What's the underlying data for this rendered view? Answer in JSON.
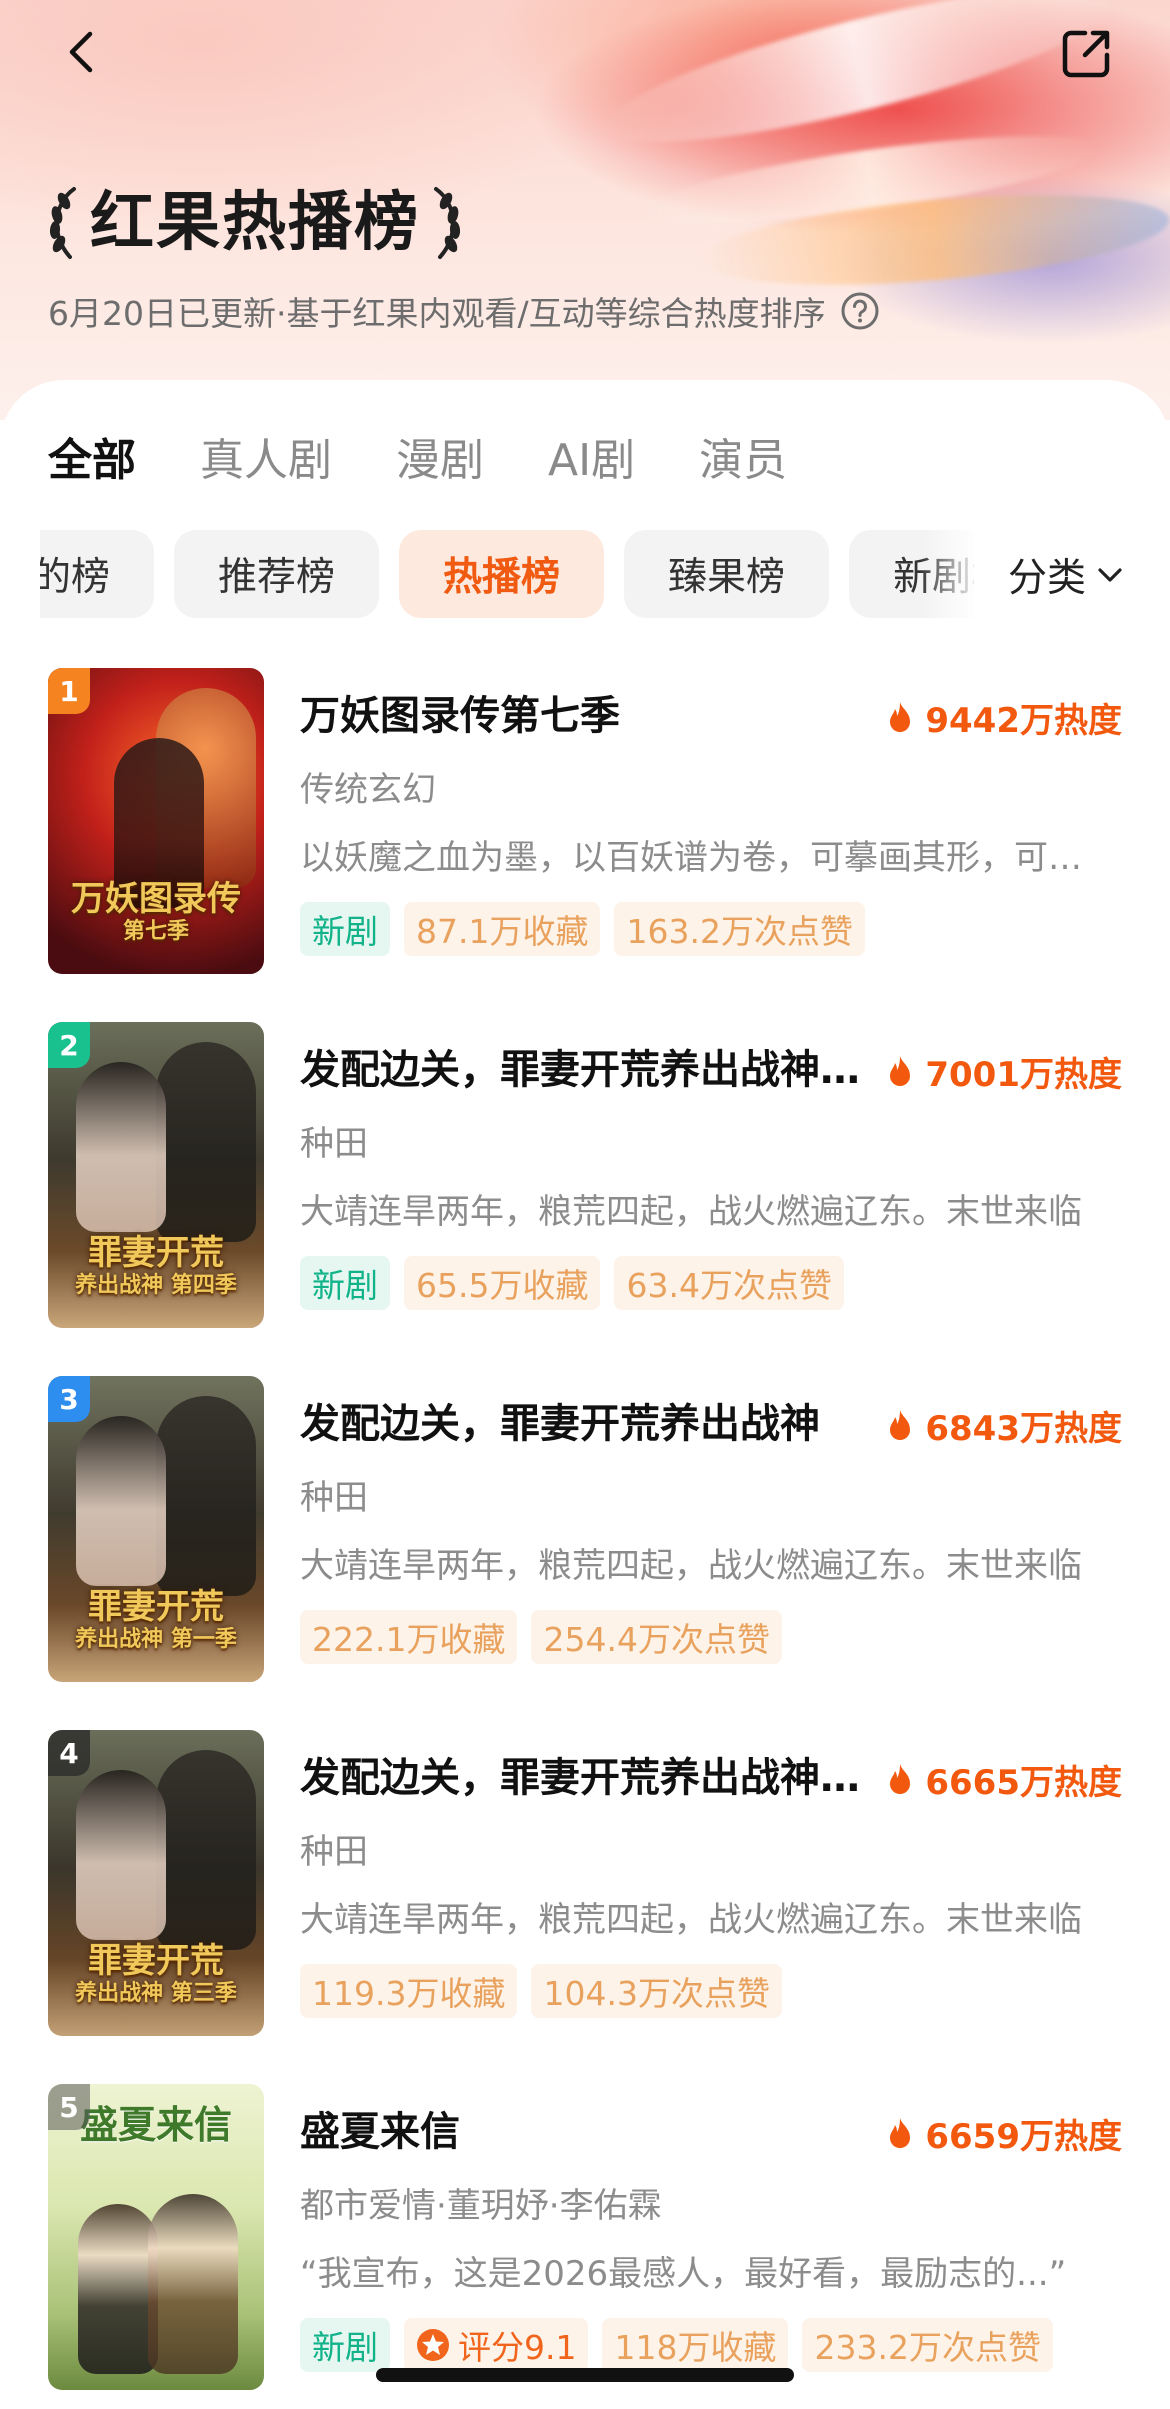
{
  "header": {
    "title": "红果热播榜",
    "subtitle": "6月20日已更新·基于红果内观看/互动等综合热度排序",
    "back_icon": "chevron-left-icon",
    "share_icon": "share-icon",
    "help_icon": "question-circle-icon"
  },
  "main_tabs": [
    {
      "label": "全部",
      "active": true
    },
    {
      "label": "真人剧",
      "active": false
    },
    {
      "label": "漫剧",
      "active": false
    },
    {
      "label": "AI剧",
      "active": false
    },
    {
      "label": "演员",
      "active": false
    }
  ],
  "chips": [
    {
      "label": "的榜",
      "active": false
    },
    {
      "label": "推荐榜",
      "active": false
    },
    {
      "label": "热播榜",
      "active": true
    },
    {
      "label": "臻果榜",
      "active": false
    },
    {
      "label": "新剧榜",
      "active": false
    }
  ],
  "category": {
    "label": "分类",
    "icon": "chevron-down-icon"
  },
  "colors": {
    "accent": "#f2590f",
    "new_tag": "#13b38a",
    "stat_tag": "#e9a25e",
    "rank1": "#f5831f",
    "rank2": "#19c18f",
    "rank3": "#2e8ef0",
    "rank_other": "#4a4a4a"
  },
  "items": [
    {
      "rank": "1",
      "title": "万妖图录传第七季",
      "heat": "9442万热度",
      "genre": "传统玄幻",
      "desc": "以妖魔之血为墨，以百妖谱为卷，可摹画其形，可借用其力",
      "cover_text": "万妖图录传",
      "cover_sub": "第七季",
      "tags": [
        {
          "type": "new",
          "text": "新剧"
        },
        {
          "type": "stat",
          "text": "87.1万收藏"
        },
        {
          "type": "stat",
          "text": "163.2万次点赞"
        }
      ]
    },
    {
      "rank": "2",
      "title": "发配边关，罪妻开荒养出战神第四季",
      "heat": "7001万热度",
      "genre": "种田",
      "desc": "大靖连旱两年，粮荒四起，战火燃遍辽东。末世来临",
      "cover_text": "罪妻开荒",
      "cover_sub": "养出战神 第四季",
      "tags": [
        {
          "type": "new",
          "text": "新剧"
        },
        {
          "type": "stat",
          "text": "65.5万收藏"
        },
        {
          "type": "stat",
          "text": "63.4万次点赞"
        }
      ]
    },
    {
      "rank": "3",
      "title": "发配边关，罪妻开荒养出战神",
      "heat": "6843万热度",
      "genre": "种田",
      "desc": "大靖连旱两年，粮荒四起，战火燃遍辽东。末世来临",
      "cover_text": "罪妻开荒",
      "cover_sub": "养出战神 第一季",
      "tags": [
        {
          "type": "stat",
          "text": "222.1万收藏"
        },
        {
          "type": "stat",
          "text": "254.4万次点赞"
        }
      ]
    },
    {
      "rank": "4",
      "title": "发配边关，罪妻开荒养出战神第三季",
      "heat": "6665万热度",
      "genre": "种田",
      "desc": "大靖连旱两年，粮荒四起，战火燃遍辽东。末世来临",
      "cover_text": "罪妻开荒",
      "cover_sub": "养出战神 第三季",
      "tags": [
        {
          "type": "stat",
          "text": "119.3万收藏"
        },
        {
          "type": "stat",
          "text": "104.3万次点赞"
        }
      ]
    },
    {
      "rank": "5",
      "title": "盛夏来信",
      "heat": "6659万热度",
      "genre": "都市爱情·董玥妤·李佑霖",
      "desc": "“我宣布，这是2026最感人，最好看，最励志的...”",
      "cover_text": "盛夏来信",
      "cover_sub": "",
      "tags": [
        {
          "type": "new",
          "text": "新剧"
        },
        {
          "type": "rating",
          "text": "评分9.1"
        },
        {
          "type": "stat",
          "text": "118万收藏"
        },
        {
          "type": "stat",
          "text": "233.2万次点赞"
        }
      ]
    }
  ]
}
